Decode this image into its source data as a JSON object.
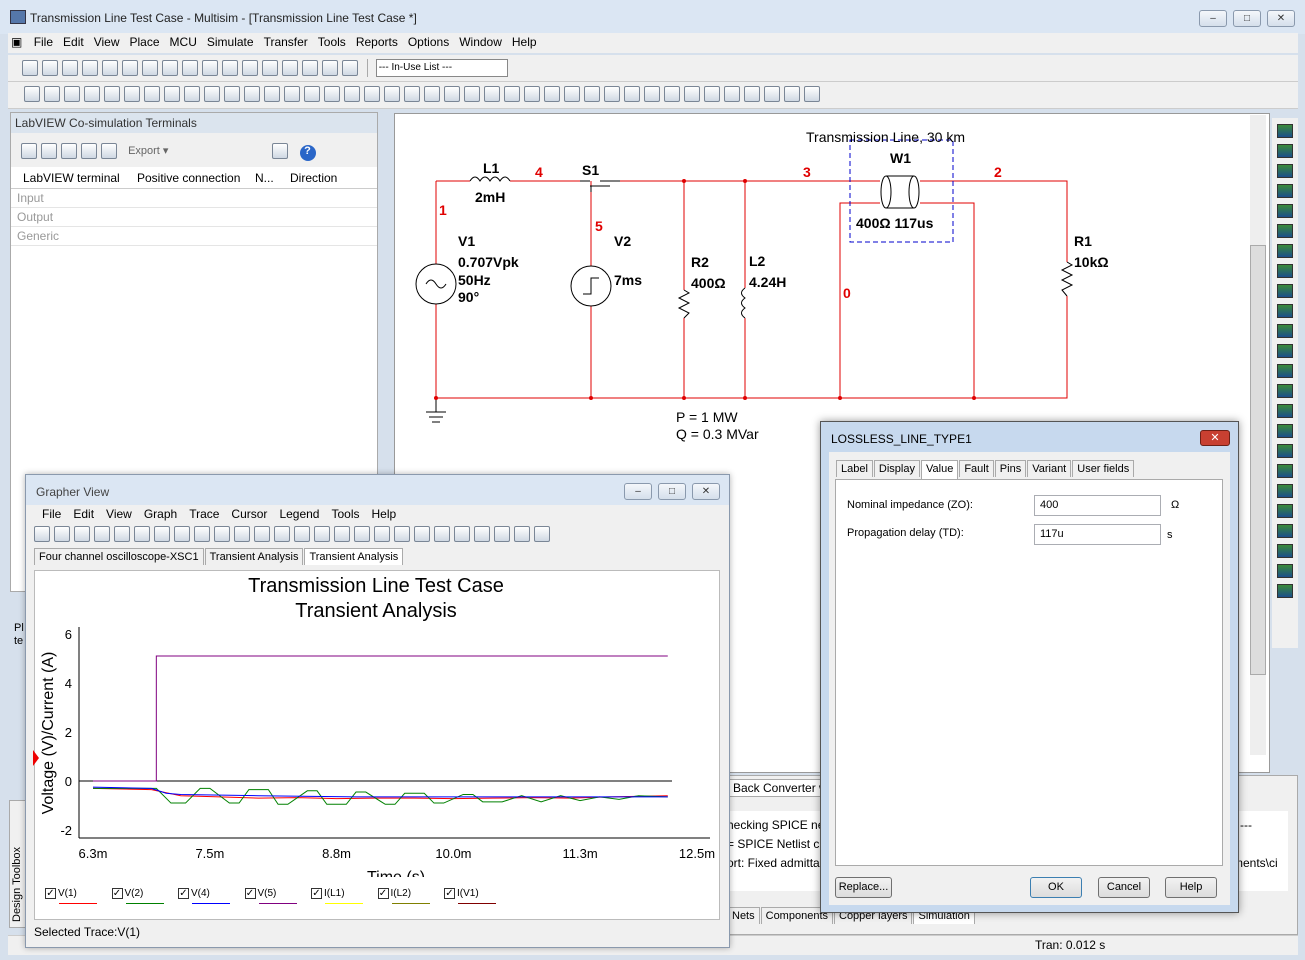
{
  "app": {
    "title": "Transmission Line Test Case - Multisim - [Transmission Line Test Case *]",
    "menu": [
      "File",
      "Edit",
      "View",
      "Place",
      "MCU",
      "Simulate",
      "Transfer",
      "Tools",
      "Reports",
      "Options",
      "Window",
      "Help"
    ],
    "in_use_list": "--- In-Use List ---"
  },
  "toolbar_icons": [
    "new-icon",
    "open-icon",
    "open-sample-icon",
    "save-icon",
    "print-icon",
    "print-preview-icon",
    "cut-icon",
    "copy-icon",
    "paste-icon",
    "undo-icon",
    "redo-icon",
    "fullscreen-icon",
    "grapher-icon",
    "spreadsheet-icon",
    "postprocessor-icon",
    "database-icon",
    "component-wizard-icon"
  ],
  "left_panel": {
    "title": "LabVIEW Co-simulation Terminals",
    "export_label": "Export",
    "columns": [
      "LabVIEW terminal",
      "Positive connection",
      "N...",
      "Direction"
    ],
    "rows": [
      "Input",
      "Output",
      "Generic"
    ]
  },
  "schematic": {
    "nodes": [
      "1",
      "4",
      "5",
      "3",
      "2",
      "0"
    ],
    "title_label": "Transmission Line, 30 km",
    "L1": {
      "name": "L1",
      "value": "2mH"
    },
    "S1": {
      "name": "S1"
    },
    "V1": {
      "name": "V1",
      "amp": "0.707Vpk",
      "freq": "50Hz",
      "phase": "90°"
    },
    "V2": {
      "name": "V2",
      "value": "7ms"
    },
    "R2": {
      "name": "R2",
      "value": "400Ω"
    },
    "L2": {
      "name": "L2",
      "value": "4.24H"
    },
    "W1": {
      "name": "W1",
      "value": "400Ω 117us"
    },
    "R1": {
      "name": "R1",
      "value": "10kΩ"
    },
    "p_label": "P = 1 MW",
    "q_label": "Q = 0.3 MVar"
  },
  "bottom": {
    "spreadsheet_tab": "Back Converter w",
    "log_lines": [
      "hecking SPICE net",
      "= SPICE Netlist c",
      "ort: Fixed admitta"
    ],
    "log_right": [
      "---",
      "ments\\ci"
    ],
    "tabs": [
      "Nets",
      "Components",
      "Copper layers",
      "Simulation"
    ],
    "status": "Tran: 0.012 s",
    "design_toolbox": "Design Toolbox",
    "left_frag": [
      "Pl",
      "te"
    ]
  },
  "grapher": {
    "title": "Grapher View",
    "menu": [
      "File",
      "Edit",
      "View",
      "Graph",
      "Trace",
      "Cursor",
      "Legend",
      "Tools",
      "Help"
    ],
    "tabs": [
      "Four channel oscilloscope-XSC1",
      "Transient Analysis",
      "Transient Analysis"
    ],
    "selected_trace": "Selected Trace:V(1)"
  },
  "chart_data": {
    "type": "line",
    "title": "Transmission Line Test Case",
    "subtitle": "Transient Analysis",
    "xlabel": "Time (s)",
    "ylabel": "Voltage (V)/Current (A)",
    "xlim": [
      0.0063,
      0.0125
    ],
    "ylim": [
      -2,
      6
    ],
    "x_ticks": [
      "6.3m",
      "7.5m",
      "8.8m",
      "10.0m",
      "11.3m",
      "12.5m"
    ],
    "y_ticks": [
      "-2",
      "0",
      "2",
      "4",
      "6"
    ],
    "grid": false,
    "legend": "bottom",
    "series": [
      {
        "name": "V(1)",
        "color": "#ff0000",
        "x": [
          0.0063,
          0.0069,
          0.0072,
          0.0076,
          0.008,
          0.0084,
          0.0088,
          0.0092,
          0.0096,
          0.01,
          0.0104,
          0.0108,
          0.0112,
          0.0116,
          0.0122
        ],
        "y": [
          -0.3,
          -0.35,
          -0.6,
          -0.65,
          -0.7,
          -0.68,
          -0.72,
          -0.7,
          -0.7,
          -0.72,
          -0.7,
          -0.68,
          -0.7,
          -0.65,
          -0.6
        ]
      },
      {
        "name": "V(2)",
        "color": "#008000",
        "x": [
          0.0063,
          0.00695,
          0.0071,
          0.00725,
          0.0074,
          0.0075,
          0.0077,
          0.0078,
          0.0079,
          0.0081,
          0.0082,
          0.0083,
          0.0085,
          0.0086,
          0.0087,
          0.0089,
          0.009,
          0.0091,
          0.0093,
          0.0094,
          0.0095,
          0.0097,
          0.0098,
          0.0099,
          0.0101,
          0.0102,
          0.0103,
          0.0105,
          0.0107,
          0.0109,
          0.0111,
          0.0113,
          0.0115,
          0.0117,
          0.0119,
          0.0122
        ],
        "y": [
          -0.3,
          -0.3,
          -0.9,
          -0.9,
          -0.3,
          -0.3,
          -0.9,
          -0.9,
          -0.35,
          -0.35,
          -0.95,
          -0.95,
          -0.4,
          -0.4,
          -0.95,
          -0.95,
          -0.45,
          -0.45,
          -0.95,
          -0.95,
          -0.5,
          -0.5,
          -0.9,
          -0.9,
          -0.55,
          -0.55,
          -0.85,
          -0.85,
          -0.6,
          -0.85,
          -0.6,
          -0.8,
          -0.65,
          -0.75,
          -0.6,
          -0.65
        ]
      },
      {
        "name": "V(4)",
        "color": "#0000ff",
        "x": [
          0.0063,
          0.0069,
          0.00705,
          0.0072,
          0.008,
          0.009,
          0.01,
          0.011,
          0.0122
        ],
        "y": [
          -0.25,
          -0.3,
          -0.5,
          -0.55,
          -0.6,
          -0.65,
          -0.65,
          -0.65,
          -0.65
        ]
      },
      {
        "name": "V(5)",
        "color": "#800080",
        "x": [
          0.0063,
          0.00695,
          0.00695,
          0.0122
        ],
        "y": [
          0,
          0,
          5.1,
          5.1
        ]
      },
      {
        "name": "I(L1)",
        "color": "#ffff00",
        "x": [],
        "y": []
      },
      {
        "name": "I(L2)",
        "color": "#808000",
        "x": [],
        "y": []
      },
      {
        "name": "I(V1)",
        "color": "#800000",
        "x": [],
        "y": []
      }
    ]
  },
  "dialog": {
    "title": "LOSSLESS_LINE_TYPE1",
    "tabs": [
      "Label",
      "Display",
      "Value",
      "Fault",
      "Pins",
      "Variant",
      "User fields"
    ],
    "fields": [
      {
        "label": "Nominal impedance (ZO):",
        "value": "400",
        "unit": "Ω"
      },
      {
        "label": "Propagation delay (TD):",
        "value": "117u",
        "unit": "s"
      }
    ],
    "buttons": {
      "replace": "Replace...",
      "ok": "OK",
      "cancel": "Cancel",
      "help": "Help"
    }
  }
}
